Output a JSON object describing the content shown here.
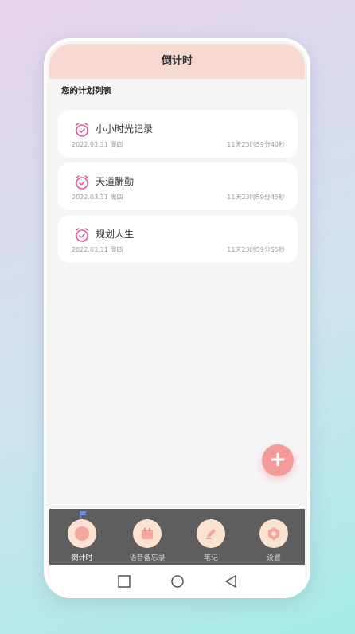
{
  "header": {
    "title": "倒计时"
  },
  "section_title": "您的计划列表",
  "plans": [
    {
      "name": "小小时光记录",
      "date": "2022.03.31  周四",
      "countdown": "11天23时59分40秒"
    },
    {
      "name": "天道酬勤",
      "date": "2022.03.31  周四",
      "countdown": "11天23时59分45秒"
    },
    {
      "name": "规划人生",
      "date": "2022.03.31  周四",
      "countdown": "11天23时59分55秒"
    }
  ],
  "fab": {
    "label": "+"
  },
  "tabs": [
    {
      "label": "倒计时",
      "icon": "alarm-icon",
      "active": true
    },
    {
      "label": "语音备忘录",
      "icon": "calendar-icon",
      "active": false
    },
    {
      "label": "笔记",
      "icon": "pen-icon",
      "active": false
    },
    {
      "label": "设置",
      "icon": "gear-icon",
      "active": false
    }
  ],
  "colors": {
    "header_bg": "#f7d9d2",
    "accent": "#f29b98",
    "icon_pink": "#e8559a",
    "tabbar_bg": "#5e5e5e"
  }
}
